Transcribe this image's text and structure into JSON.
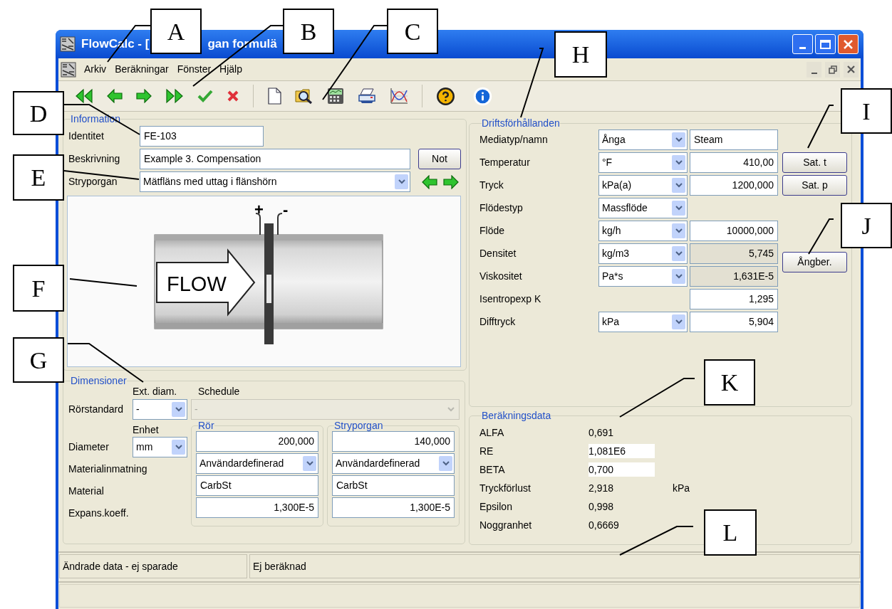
{
  "window": {
    "title_parts": [
      "FlowCalc - [",
      "gan formulä"
    ]
  },
  "menu": [
    "Arkiv",
    "Beräkningar",
    "Fönster",
    "Hjälp"
  ],
  "information": {
    "title": "Information",
    "fields": [
      {
        "label": "Identitet",
        "kind": "input",
        "value": "FE-103"
      },
      {
        "label": "Beskrivning",
        "kind": "input",
        "value": "Example 3. Compensation"
      },
      {
        "label": "Stryporgan",
        "kind": "select",
        "value": "Mätfläns med uttag i flänshörn"
      }
    ],
    "note_button": "Not",
    "diagram": {
      "plus": "+",
      "minus": "-",
      "arrow_text": "FLOW"
    }
  },
  "operating": {
    "title": "Driftsförhållanden",
    "rows": [
      {
        "label": "Mediatyp/namn",
        "unit": "Ånga",
        "value": "Steam",
        "kind": "text"
      },
      {
        "label": "Temperatur",
        "unit": "°F",
        "value": "410,00",
        "kind": "number"
      },
      {
        "label": "Tryck",
        "unit": "kPa(a)",
        "value": "1200,000",
        "kind": "number"
      },
      {
        "label": "Flödestyp",
        "unit": "Massflöde"
      },
      {
        "label": "Flöde",
        "unit": "kg/h",
        "value": "10000,000",
        "kind": "number"
      },
      {
        "label": "Densitet",
        "unit": "kg/m3",
        "value": "5,745",
        "kind": "readonly"
      },
      {
        "label": "Viskositet",
        "unit": "Pa*s",
        "value": "1,631E-5",
        "kind": "readonly"
      },
      {
        "label": "Isentropexp K",
        "value": "1,295",
        "kind": "number"
      },
      {
        "label": "Difftryck",
        "unit": "kPa",
        "value": "5,904",
        "kind": "number"
      }
    ],
    "buttons": [
      "Sat. t",
      "Sat. p",
      "Ångber."
    ]
  },
  "dimensions": {
    "title": "Dimensioner",
    "ext_diam_label": "Ext. diam.",
    "schedule_label": "Schedule",
    "pipe_standard": {
      "label": "Rörstandard",
      "value": "-"
    },
    "schedule": {
      "value": "-",
      "disabled": true
    },
    "unit_label": "Enhet",
    "groups": [
      "Rör",
      "Stryporgan"
    ],
    "rows": [
      {
        "label": "Diameter",
        "unit": "mm",
        "cells": [
          {
            "kind": "number",
            "value": "200,000"
          },
          {
            "kind": "number",
            "value": "140,000"
          }
        ]
      },
      {
        "label": "Materialinmatning",
        "cells": [
          {
            "kind": "select",
            "value": "Användardefinerad"
          },
          {
            "kind": "select",
            "value": "Användardefinerad"
          }
        ]
      },
      {
        "label": "Material",
        "cells": [
          {
            "kind": "text",
            "value": "CarbSt"
          },
          {
            "kind": "text",
            "value": "CarbSt"
          }
        ]
      },
      {
        "label": "Expans.koeff.",
        "cells": [
          {
            "kind": "number",
            "value": "1,300E-5"
          },
          {
            "kind": "number",
            "value": "1,300E-5"
          }
        ]
      }
    ]
  },
  "results": {
    "title": "Beräkningsdata",
    "rows": [
      {
        "label": "ALFA",
        "value": "0,691",
        "boxed": false
      },
      {
        "label": "RE",
        "value": "1,081E6",
        "boxed": true
      },
      {
        "label": "BETA",
        "value": "0,700",
        "boxed": true
      },
      {
        "label": "Tryckförlust",
        "value": "2,918",
        "unit": "kPa",
        "boxed": false
      },
      {
        "label": "Epsilon",
        "value": "0,998",
        "boxed": false
      },
      {
        "label": "Noggranhet",
        "value": "0,6669",
        "boxed": false
      }
    ]
  },
  "status_bar": [
    "Ändrade data - ej sparade",
    "Ej beräknad"
  ],
  "callouts": [
    {
      "letter": "A"
    },
    {
      "letter": "B"
    },
    {
      "letter": "C"
    },
    {
      "letter": "D"
    },
    {
      "letter": "E"
    },
    {
      "letter": "F"
    },
    {
      "letter": "G"
    },
    {
      "letter": "H"
    },
    {
      "letter": "I"
    },
    {
      "letter": "J"
    },
    {
      "letter": "K"
    },
    {
      "letter": "L"
    }
  ]
}
